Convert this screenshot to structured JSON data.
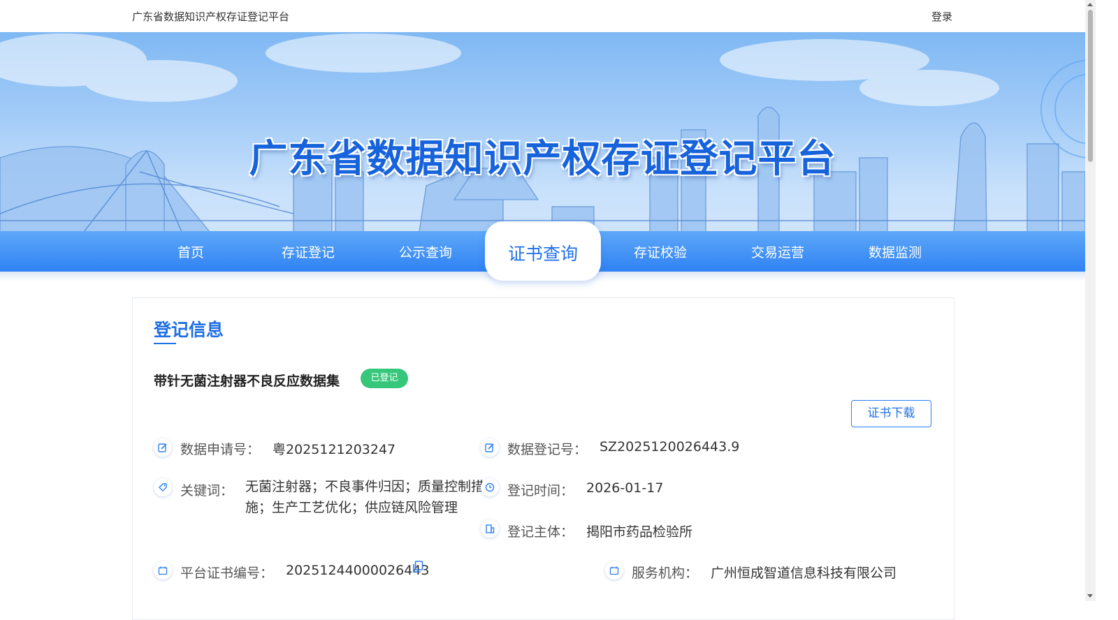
{
  "header": {
    "site_name": "广东省数据知识产权存证登记平台",
    "login_label": "登录"
  },
  "hero": {
    "title": "广东省数据知识产权存证登记平台"
  },
  "nav": {
    "items": [
      {
        "label": "首页"
      },
      {
        "label": "存证登记"
      },
      {
        "label": "公示查询"
      },
      {
        "label": "证书查询",
        "active": true
      },
      {
        "label": "存证校验"
      },
      {
        "label": "交易运营"
      },
      {
        "label": "数据监测"
      }
    ]
  },
  "section": {
    "title": "登记信息"
  },
  "record": {
    "dataset_name": "带针无菌注射器不良反应数据集",
    "status": "已登记",
    "download_label": "证书下载",
    "fields": {
      "application_no_label": "数据申请号：",
      "application_no": "粤2025121203247",
      "registration_no_label": "数据登记号：",
      "registration_no": "SZ2025120026443.9",
      "keywords_label": "关键词：",
      "keywords": "无菌注射器；不良事件归因；质量控制措施；生产工艺优化；供应链风险管理",
      "registration_time_label": "登记时间：",
      "registration_time": "2026-01-17",
      "registrant_label": "登记主体：",
      "registrant": "揭阳市药品检验所",
      "certificate_no_label": "平台证书编号：",
      "certificate_no": "20251244000026443",
      "service_org_label": "服务机构：",
      "service_org": "广州恒成智道信息科技有限公司"
    }
  },
  "colors": {
    "primary": "#1f6fe6",
    "nav_top": "#5ea8f8",
    "nav_bottom": "#2f82f4",
    "status_green": "#36c77a"
  },
  "icons": [
    "edit-icon",
    "tag-icon",
    "clock-icon",
    "building-icon",
    "calendar-icon",
    "copy-icon"
  ]
}
